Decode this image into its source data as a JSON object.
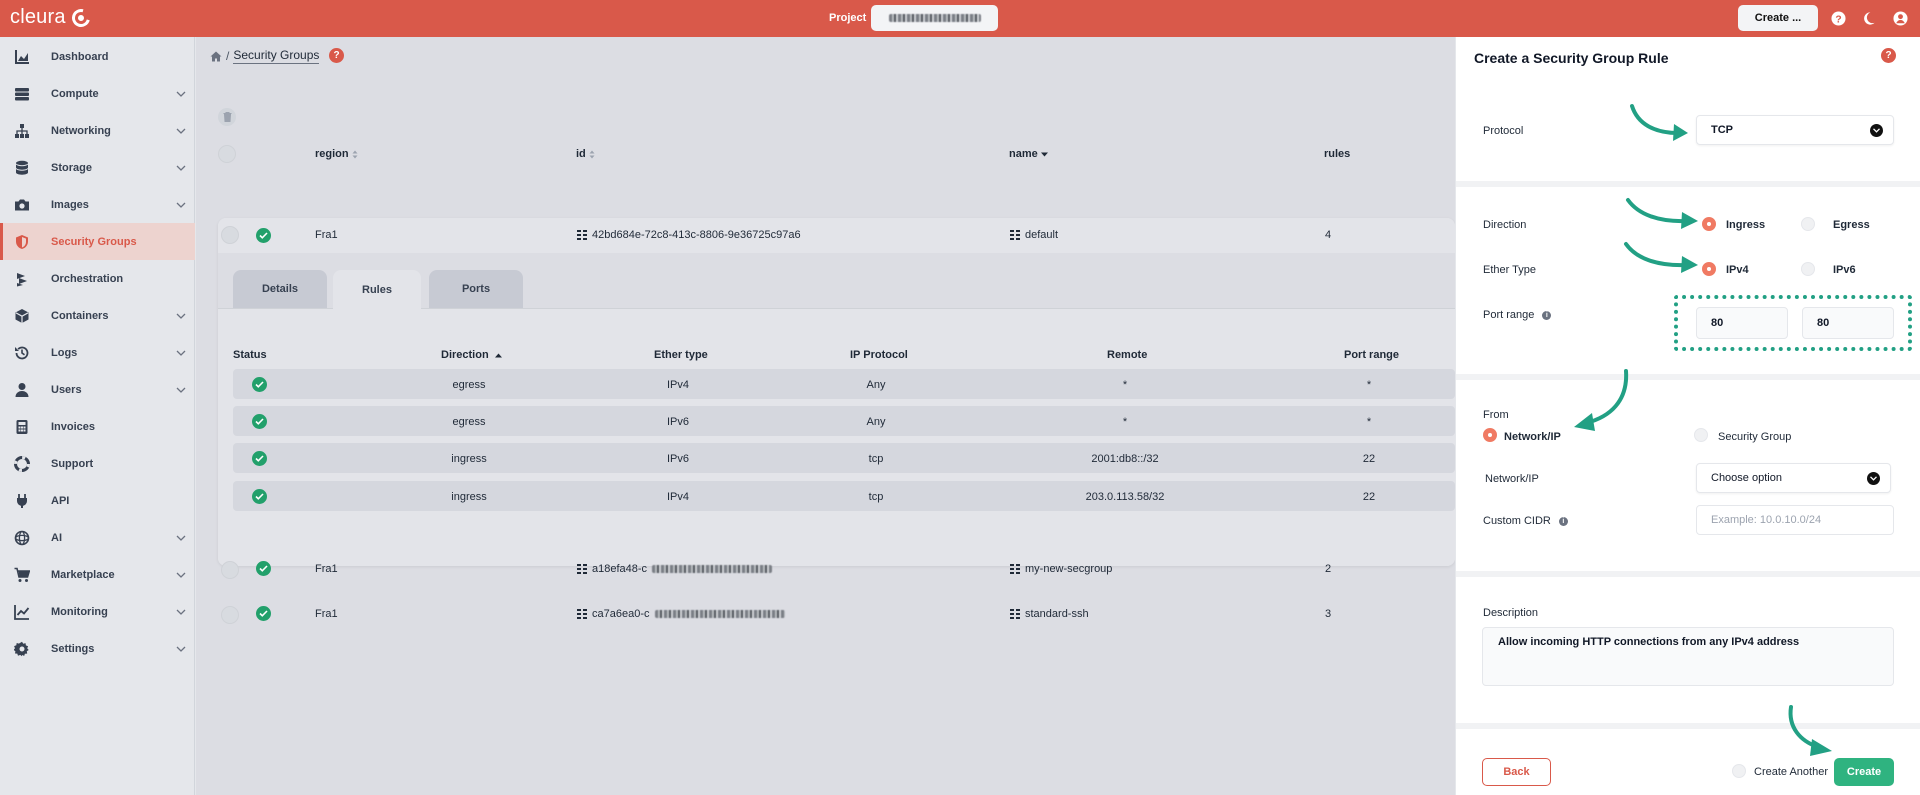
{
  "topbar": {
    "logo": "cleura",
    "project_label": "Project",
    "create_button": "Create ..."
  },
  "sidebar": {
    "items": [
      {
        "label": "Dashboard",
        "icon": "chart-area-icon",
        "expandable": false,
        "active": false
      },
      {
        "label": "Compute",
        "icon": "server-icon",
        "expandable": true,
        "active": false
      },
      {
        "label": "Networking",
        "icon": "network-icon",
        "expandable": true,
        "active": false
      },
      {
        "label": "Storage",
        "icon": "database-icon",
        "expandable": true,
        "active": false
      },
      {
        "label": "Images",
        "icon": "camera-icon",
        "expandable": true,
        "active": false
      },
      {
        "label": "Security Groups",
        "icon": "shield-icon",
        "expandable": false,
        "active": true
      },
      {
        "label": "Orchestration",
        "icon": "orchestration-icon",
        "expandable": false,
        "active": false
      },
      {
        "label": "Containers",
        "icon": "cube-icon",
        "expandable": true,
        "active": false
      },
      {
        "label": "Logs",
        "icon": "history-icon",
        "expandable": true,
        "active": false
      },
      {
        "label": "Users",
        "icon": "user-icon",
        "expandable": true,
        "active": false
      },
      {
        "label": "Invoices",
        "icon": "calculator-icon",
        "expandable": false,
        "active": false
      },
      {
        "label": "Support",
        "icon": "lifebuoy-icon",
        "expandable": false,
        "active": false
      },
      {
        "label": "API",
        "icon": "plug-icon",
        "expandable": false,
        "active": false
      },
      {
        "label": "AI",
        "icon": "ai-icon",
        "expandable": true,
        "active": false
      },
      {
        "label": "Marketplace",
        "icon": "cart-icon",
        "expandable": true,
        "active": false
      },
      {
        "label": "Monitoring",
        "icon": "chart-line-icon",
        "expandable": true,
        "active": false
      },
      {
        "label": "Settings",
        "icon": "gear-icon",
        "expandable": true,
        "active": false
      }
    ]
  },
  "main": {
    "breadcrumb_title": "Security Groups",
    "columns": {
      "region": "region",
      "id": "id",
      "name": "name",
      "rules": "rules"
    },
    "groups": [
      {
        "region": "Fra1",
        "id": "42bd684e-72c8-413c-8806-9e36725c97a6",
        "name": "default",
        "rules": "4"
      },
      {
        "region": "Fra1",
        "id": "a18efa48-c",
        "name": "my-new-secgroup",
        "rules": "2"
      },
      {
        "region": "Fra1",
        "id": "ca7a6ea0-c",
        "name": "standard-ssh",
        "rules": "3"
      }
    ],
    "tabs": [
      "Details",
      "Rules",
      "Ports"
    ],
    "active_tab": "Rules",
    "rules_table": {
      "headers": [
        "Status",
        "Direction",
        "Ether type",
        "IP Protocol",
        "Remote",
        "Port range"
      ],
      "rows": [
        {
          "direction": "egress",
          "ether": "IPv4",
          "protocol": "Any",
          "remote": "*",
          "port": "*"
        },
        {
          "direction": "egress",
          "ether": "IPv6",
          "protocol": "Any",
          "remote": "*",
          "port": "*"
        },
        {
          "direction": "ingress",
          "ether": "IPv6",
          "protocol": "tcp",
          "remote": "2001:db8::/32",
          "port": "22"
        },
        {
          "direction": "ingress",
          "ether": "IPv4",
          "protocol": "tcp",
          "remote": "203.0.113.58/32",
          "port": "22"
        }
      ]
    }
  },
  "panel": {
    "title": "Create a Security Group Rule",
    "protocol_label": "Protocol",
    "protocol_value": "TCP",
    "direction_label": "Direction",
    "direction_options": [
      "Ingress",
      "Egress"
    ],
    "direction_selected": "Ingress",
    "ether_label": "Ether Type",
    "ether_options": [
      "IPv4",
      "IPv6"
    ],
    "ether_selected": "IPv4",
    "port_range_label": "Port range",
    "port_from": "80",
    "port_to": "80",
    "from_label": "From",
    "from_options": [
      "Network/IP",
      "Security Group"
    ],
    "from_selected": "Network/IP",
    "network_label": "Network/IP",
    "network_select": "Choose option",
    "cidr_label": "Custom CIDR",
    "cidr_placeholder": "Example: 10.0.10.0/24",
    "description_label": "Description",
    "description_value": "Allow incoming HTTP connections from any IPv4 address",
    "back_button": "Back",
    "create_another": "Create Another",
    "create_button": "Create"
  },
  "colors": {
    "brand": "#d9594a",
    "success": "#22a06b",
    "create": "#2fb380",
    "annotation": "#22a084"
  }
}
